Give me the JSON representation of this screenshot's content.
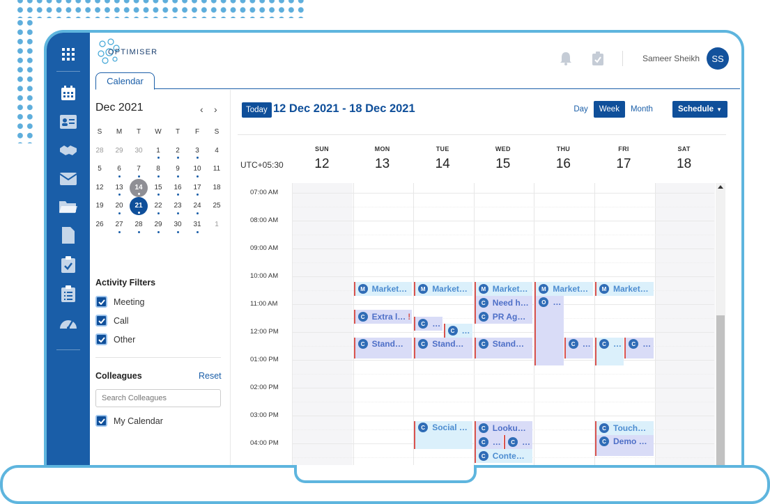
{
  "app": {
    "brand": "OPTIMISER",
    "tab_label": "Calendar",
    "user_name": "Sameer Sheikh",
    "user_initials": "SS"
  },
  "sidebar": {
    "items": [
      "apps-grid-icon",
      "calendar-icon",
      "contact-card-icon",
      "handshake-icon",
      "mail-icon",
      "folder-icon",
      "document-icon",
      "clipboard-check-icon",
      "clipboard-list-icon",
      "dashboard-gauge-icon"
    ]
  },
  "mini_calendar": {
    "title": "Dec 2021",
    "prev": "‹",
    "next": "›",
    "weekdays": [
      "S",
      "M",
      "T",
      "W",
      "T",
      "F",
      "S"
    ],
    "weeks": [
      [
        "28",
        "29",
        "30",
        "1",
        "2",
        "3",
        "4"
      ],
      [
        "5",
        "6",
        "7",
        "8",
        "9",
        "10",
        "11"
      ],
      [
        "12",
        "13",
        "14",
        "15",
        "16",
        "17",
        "18"
      ],
      [
        "19",
        "20",
        "21",
        "22",
        "23",
        "24",
        "25"
      ],
      [
        "26",
        "27",
        "28",
        "29",
        "30",
        "31",
        "1"
      ]
    ]
  },
  "filters": {
    "title": "Activity Filters",
    "items": [
      "Meeting",
      "Call",
      "Other"
    ]
  },
  "colleagues": {
    "title": "Colleagues",
    "reset": "Reset",
    "search_placeholder": "Search Colleagues",
    "my_calendar": "My Calendar"
  },
  "toolbar": {
    "today": "Today",
    "range": "12 Dec 2021 - 18 Dec 2021",
    "views": [
      "Day",
      "Week",
      "Month"
    ],
    "active_view": "Week",
    "schedule": "Schedule"
  },
  "week": {
    "timezone": "UTC+05:30",
    "days": [
      {
        "name": "SUN",
        "date": "12"
      },
      {
        "name": "MON",
        "date": "13"
      },
      {
        "name": "TUE",
        "date": "14"
      },
      {
        "name": "WED",
        "date": "15"
      },
      {
        "name": "THU",
        "date": "16"
      },
      {
        "name": "FRI",
        "date": "17"
      },
      {
        "name": "SAT",
        "date": "18"
      }
    ],
    "times": [
      "07:00 AM",
      "08:00 AM",
      "09:00 AM",
      "10:00 AM",
      "11:00 AM",
      "12:00 PM",
      "01:00 PM",
      "02:00 PM",
      "03:00 PM",
      "04:00 PM"
    ]
  },
  "events": [
    {
      "badge": "M",
      "title": "Market…"
    },
    {
      "badge": "M",
      "title": "Market…"
    },
    {
      "badge": "M",
      "title": "Market…"
    },
    {
      "badge": "M",
      "title": "Market…"
    },
    {
      "badge": "M",
      "title": "Market…"
    },
    {
      "badge": "C",
      "title": "Need h…"
    },
    {
      "badge": "O",
      "title": "…"
    },
    {
      "badge": "C",
      "title": "Extra l…",
      "flag": "!"
    },
    {
      "badge": "C",
      "title": "PR Ag…"
    },
    {
      "badge": "C",
      "title": "…"
    },
    {
      "badge": "C",
      "title": "…"
    },
    {
      "badge": "C",
      "title": "Stand…"
    },
    {
      "badge": "C",
      "title": "Stand…"
    },
    {
      "badge": "C",
      "title": "Stand…"
    },
    {
      "badge": "C",
      "title": "…"
    },
    {
      "badge": "C",
      "title": "…"
    },
    {
      "badge": "C",
      "title": "…"
    },
    {
      "badge": "C",
      "title": "Social …"
    },
    {
      "badge": "C",
      "title": "Looku…"
    },
    {
      "badge": "C",
      "title": "Touch…"
    },
    {
      "badge": "C",
      "title": "…"
    },
    {
      "badge": "C",
      "title": "…"
    },
    {
      "badge": "C",
      "title": "Demo …"
    },
    {
      "badge": "C",
      "title": "Conte…"
    }
  ],
  "colors": {
    "primary": "#0f4f9a",
    "sidebar": "#1a5ea8",
    "frame": "#5eb5de",
    "event_blue": "#dbf0fb",
    "event_lavender": "#d9dcf7",
    "event_border": "#d9534f"
  }
}
